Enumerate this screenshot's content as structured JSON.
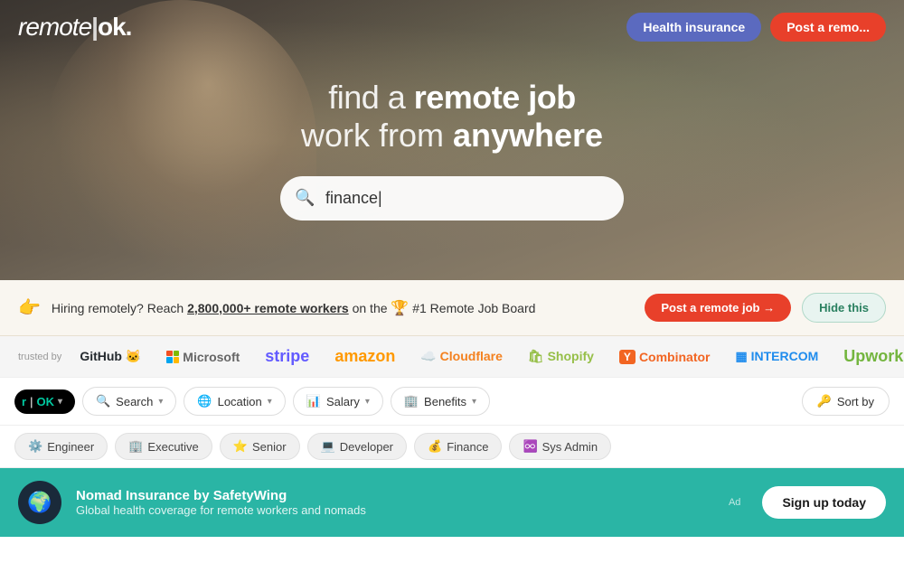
{
  "navbar": {
    "logo": "remote|ok.",
    "health_insurance_label": "Health insurance",
    "post_remote_label": "Post a remo..."
  },
  "hero": {
    "line1": "find a ",
    "line1_bold": "remote job",
    "line2": "work from ",
    "line2_bold": "anywhere",
    "search_placeholder": "",
    "search_value": "finance|"
  },
  "promo": {
    "emoji": "👉",
    "text_before": "Hiring remotely? Reach ",
    "link_text": "2,800,000+ remote workers",
    "text_after": " on the ",
    "trophy": "🏆",
    "text_rank": "#1 Remote Job Board",
    "post_label": "Post a remote job →",
    "hide_label": "Hide this"
  },
  "trusted": {
    "label": "trusted by",
    "logos": [
      {
        "name": "GitHub",
        "emoji": "🐱",
        "class": "logo-github"
      },
      {
        "name": "Microsoft",
        "class": "logo-microsoft"
      },
      {
        "name": "stripe",
        "class": "logo-stripe"
      },
      {
        "name": "amazon",
        "class": "logo-amazon"
      },
      {
        "name": "Cloudflare",
        "emoji": "☁️",
        "class": "logo-cloudflare"
      },
      {
        "name": "Shopify",
        "emoji": "🛍",
        "class": "logo-shopify"
      },
      {
        "name": "Y Combinator",
        "class": "logo-ycombinator"
      },
      {
        "name": "INTERCOM",
        "class": "logo-intercom"
      },
      {
        "name": "Upwork",
        "class": "logo-upwork"
      }
    ]
  },
  "filters": {
    "logo_text": "OK",
    "search_label": "Search",
    "location_label": "Location",
    "salary_label": "Salary",
    "benefits_label": "Benefits",
    "sort_label": "Sort by"
  },
  "tags": [
    {
      "emoji": "⚙️",
      "label": "Engineer"
    },
    {
      "emoji": "🏢",
      "label": "Executive"
    },
    {
      "emoji": "⭐",
      "label": "Senior"
    },
    {
      "emoji": "💻",
      "label": "Developer"
    },
    {
      "emoji": "💰",
      "label": "Finance"
    },
    {
      "emoji": "♾️",
      "label": "Sys Admin"
    }
  ],
  "bottom_banner": {
    "icon": "🌍",
    "title": "Nomad Insurance by SafetyWing",
    "subtitle": "Global health coverage for remote workers and nomads",
    "ad_label": "Ad",
    "signup_label": "Sign up today"
  }
}
